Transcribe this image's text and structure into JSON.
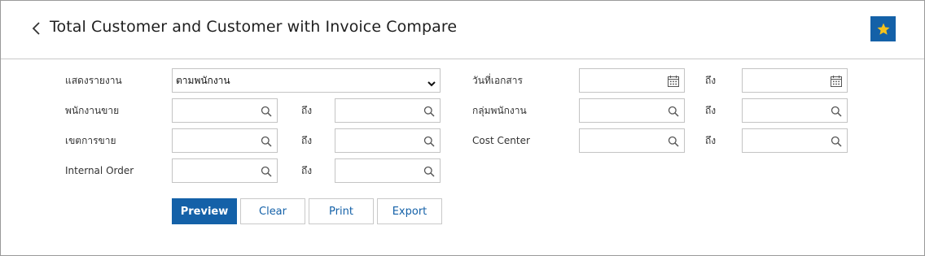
{
  "header": {
    "title": "Total Customer and Customer with Invoice Compare",
    "accent_color": "#1461a8",
    "back_icon": "chevron-left-icon",
    "favorite_icon": "star-icon"
  },
  "filters": {
    "report_label": "แสดงรายงาน",
    "report_value": "ตามพนักงาน",
    "salesperson_label": "พนักงานขาย",
    "sales_area_label": "เขตการขาย",
    "internal_order_label": "Internal Order",
    "doc_date_label": "วันที่เอกสาร",
    "employee_group_label": "กลุ่มพนักงาน",
    "cost_center_label": "Cost Center",
    "to_label": "ถึง"
  },
  "buttons": {
    "preview": "Preview",
    "clear": "Clear",
    "print": "Print",
    "export": "Export"
  }
}
